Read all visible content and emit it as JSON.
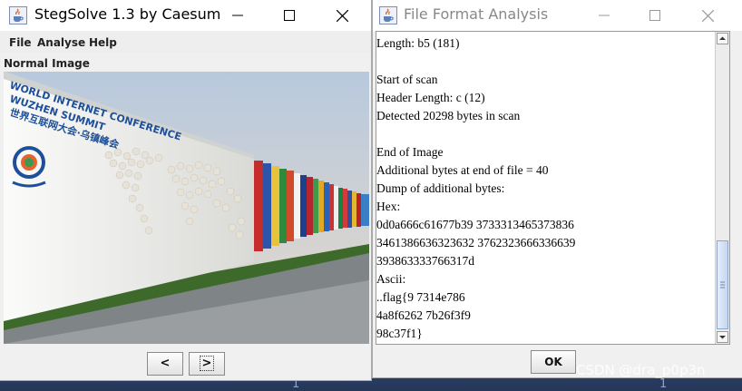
{
  "steg_window": {
    "title": "StegSolve 1.3 by Caesum",
    "menu": [
      "File",
      "Analyse",
      "Help"
    ],
    "panel_label": "Normal Image",
    "image": {
      "banner_line1": "WORLD INTERNET CONFERENCE",
      "banner_line2": "WUZHEN SUMMIT",
      "banner_cn": "世界互联网大会·乌镇峰会"
    },
    "prev_button": "<",
    "next_button": ">"
  },
  "ffa_window": {
    "title": "File Format Analysis",
    "lines": [
      "Length: b5 (181)",
      "",
      "Start of scan",
      "Header Length: c (12)",
      "Detected 20298 bytes in scan",
      "",
      "End of Image",
      "Additional bytes at end of file = 40",
      "Dump of additional bytes:",
      "Hex:",
      "0d0a666c61677b39 3733313465373836",
      "3461386636323632 3762323666336639",
      "393863333766317d",
      "Ascii:",
      "..flag{9 7314e786",
      "4a8f6262 7b26f3f9",
      "98c37f1}"
    ],
    "ok_button": "OK"
  },
  "desktop": {
    "marks": [
      "1",
      "1"
    ]
  },
  "watermark": "CSDN @dra_p0p3n",
  "colors": {
    "desktop": "#2a3f63",
    "window_bg": "#f0f0f0",
    "scroll_thumb": "#c5d6ee"
  }
}
